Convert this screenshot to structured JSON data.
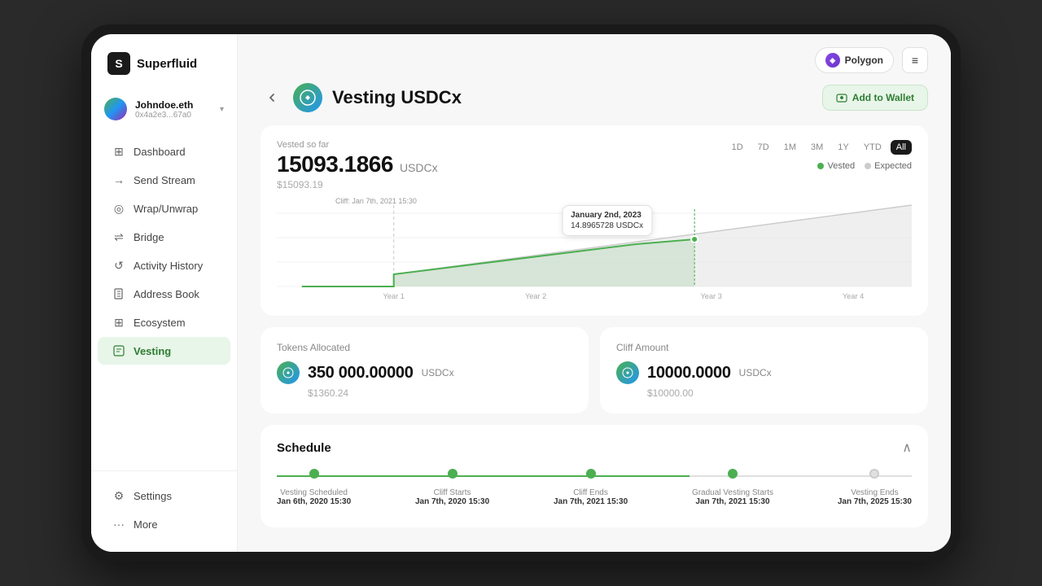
{
  "app": {
    "name": "Superfluid"
  },
  "user": {
    "name": "Johndoe.eth",
    "address": "0x4a2e3...67a0",
    "avatar_gradient": "linear-gradient(135deg, #4CAF50, #2196F3, #9C27B0)"
  },
  "network": {
    "name": "Polygon",
    "icon": "◈"
  },
  "sidebar": {
    "items": [
      {
        "id": "dashboard",
        "label": "Dashboard",
        "icon": "⊞",
        "active": false
      },
      {
        "id": "send-stream",
        "label": "Send Stream",
        "icon": "→",
        "active": false
      },
      {
        "id": "wrap-unwrap",
        "label": "Wrap/Unwrap",
        "icon": "◎",
        "active": false
      },
      {
        "id": "bridge",
        "label": "Bridge",
        "icon": "⇌",
        "active": false
      },
      {
        "id": "activity-history",
        "label": "Activity History",
        "icon": "↺",
        "active": false
      },
      {
        "id": "address-book",
        "label": "Address Book",
        "icon": "📖",
        "active": false
      },
      {
        "id": "ecosystem",
        "label": "Ecosystem",
        "icon": "⊞",
        "active": false
      },
      {
        "id": "vesting",
        "label": "Vesting",
        "icon": "📋",
        "active": true
      }
    ],
    "bottom_items": [
      {
        "id": "settings",
        "label": "Settings",
        "icon": "⚙"
      },
      {
        "id": "more",
        "label": "More",
        "icon": "···"
      }
    ]
  },
  "page": {
    "title": "Vesting USDCx",
    "token_symbol": "USDCx",
    "add_wallet_label": "Add to Wallet",
    "back_label": "←"
  },
  "chart": {
    "vested_label": "Vested so far",
    "amount": "15093.1866",
    "token": "USDCx",
    "usd_value": "$15093.19",
    "time_filters": [
      "1D",
      "7D",
      "1M",
      "3M",
      "1Y",
      "YTD",
      "All"
    ],
    "active_filter": "All",
    "legend": {
      "vested_label": "Vested",
      "expected_label": "Expected"
    },
    "cliff_label": "Cliff: Jan 7th, 2021 15:30",
    "tooltip": {
      "date": "January 2nd, 2023",
      "value": "14.8965728 USDCx"
    },
    "x_labels": [
      "Year 1",
      "Year 2",
      "Year 3",
      "Year 4"
    ]
  },
  "stats": [
    {
      "id": "tokens-allocated",
      "label": "Tokens Allocated",
      "amount": "350 000.00000",
      "token": "USDCx",
      "usd_value": "$1360.24"
    },
    {
      "id": "cliff-amount",
      "label": "Cliff Amount",
      "amount": "10000.0000",
      "token": "USDCx",
      "usd_value": "$10000.00"
    }
  ],
  "schedule": {
    "title": "Schedule",
    "collapse_icon": "^",
    "milestones": [
      {
        "id": "vesting-scheduled",
        "label": "Vesting Scheduled",
        "date": "Jan 6th, 2020 15:30",
        "active": true
      },
      {
        "id": "cliff-starts",
        "label": "Cliff Starts",
        "date": "Jan 7th, 2020 15:30",
        "active": true
      },
      {
        "id": "cliff-ends",
        "label": "Cliff Ends",
        "date": "Jan 7th, 2021 15:30",
        "active": true
      },
      {
        "id": "gradual-vesting-starts",
        "label": "Gradual Vesting Starts",
        "date": "Jan 7th, 2021 15:30",
        "active": true
      },
      {
        "id": "vesting-ends",
        "label": "Vesting Ends",
        "date": "Jan 7th, 2025 15:30",
        "active": false
      }
    ]
  },
  "colors": {
    "green": "#4CAF50",
    "green_light": "#e8f5e9",
    "green_dark": "#2e7d32",
    "purple": "#8247e5",
    "accent": "#1a1a1a"
  }
}
